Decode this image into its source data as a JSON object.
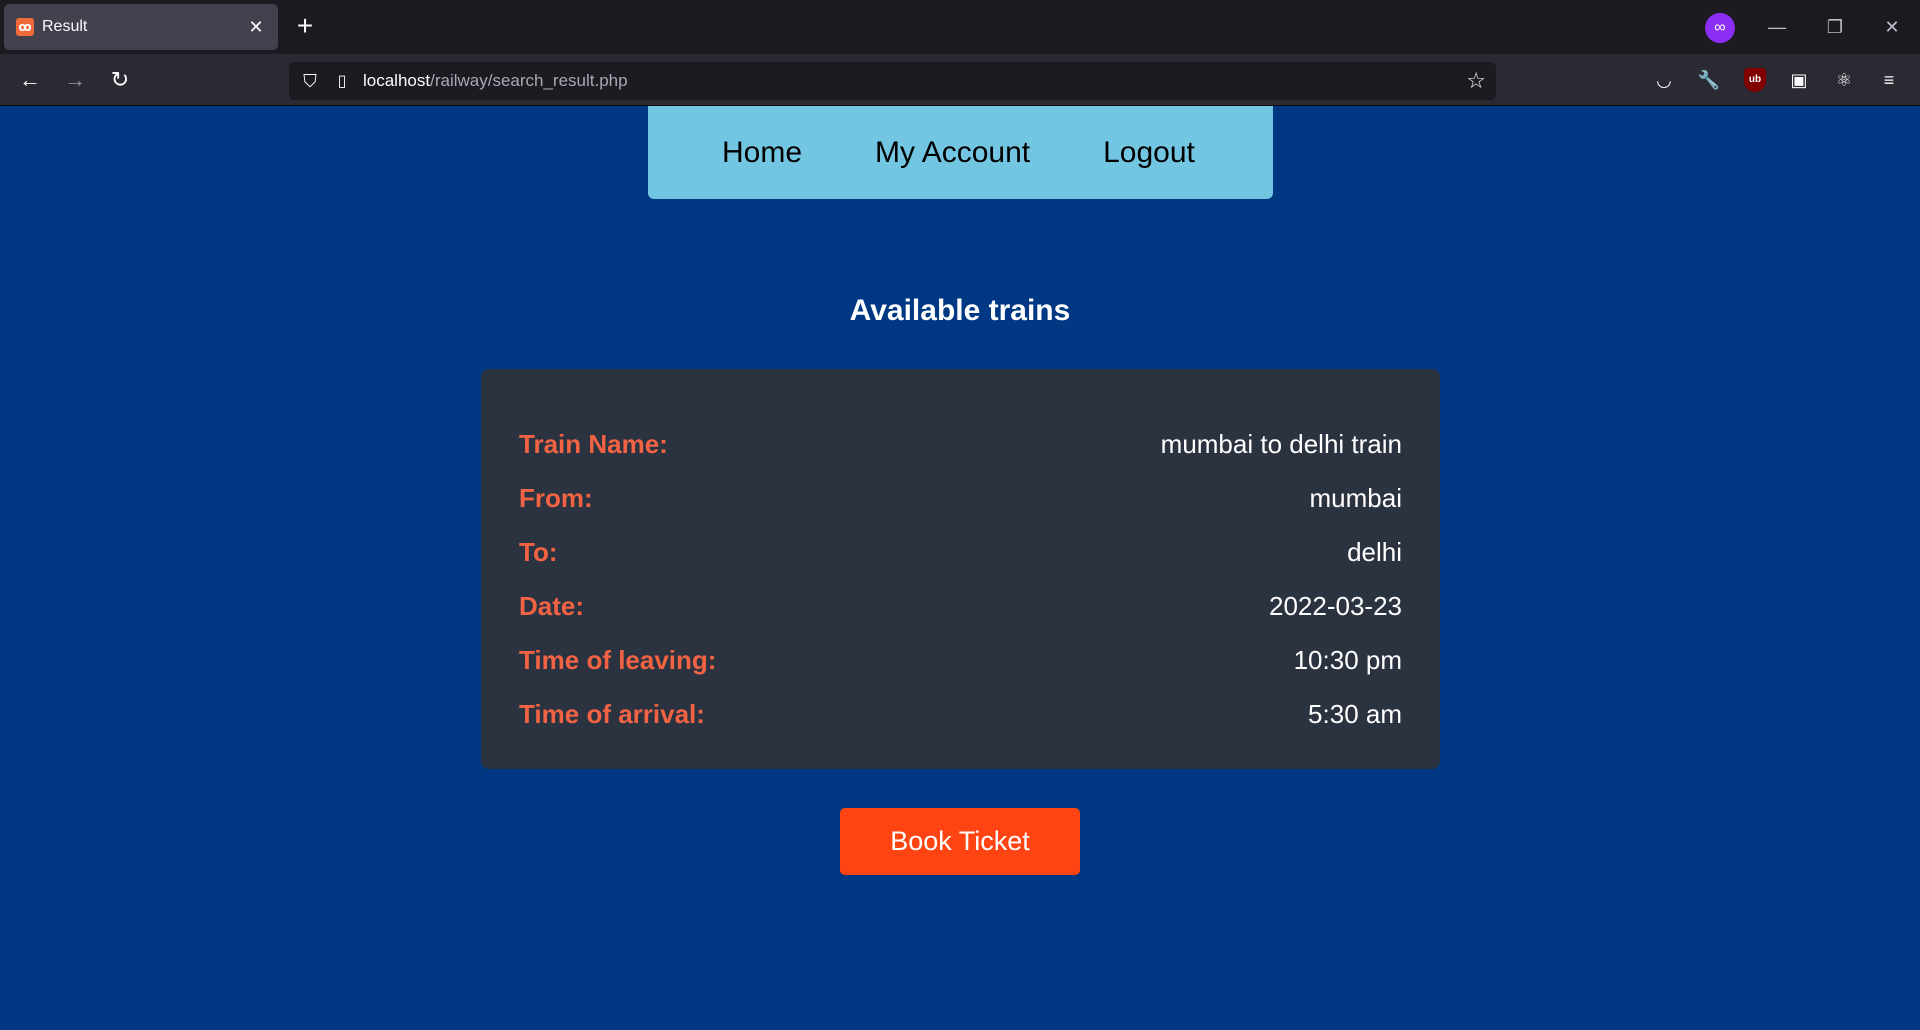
{
  "browser": {
    "tab_title": "Result",
    "tab_favicon": "ꝏ",
    "url_host": "localhost",
    "url_path": "/railway/search_result.php"
  },
  "nav": {
    "home": "Home",
    "account": "My Account",
    "logout": "Logout"
  },
  "page": {
    "heading": "Available trains",
    "rows": [
      {
        "label": "Train Name:",
        "value": "mumbai to delhi train"
      },
      {
        "label": "From:",
        "value": "mumbai"
      },
      {
        "label": "To:",
        "value": "delhi"
      },
      {
        "label": "Date:",
        "value": "2022-03-23"
      },
      {
        "label": "Time of leaving:",
        "value": "10:30 pm"
      },
      {
        "label": "Time of arrival:",
        "value": "5:30 am"
      }
    ],
    "book_button": "Book Ticket"
  },
  "colors": {
    "page_bg": "#003883",
    "nav_bg": "#73c6e2",
    "card_bg": "#2b3240",
    "label": "#f26343",
    "button": "#ff4413"
  },
  "icons": {
    "ublock_text": "ub"
  }
}
